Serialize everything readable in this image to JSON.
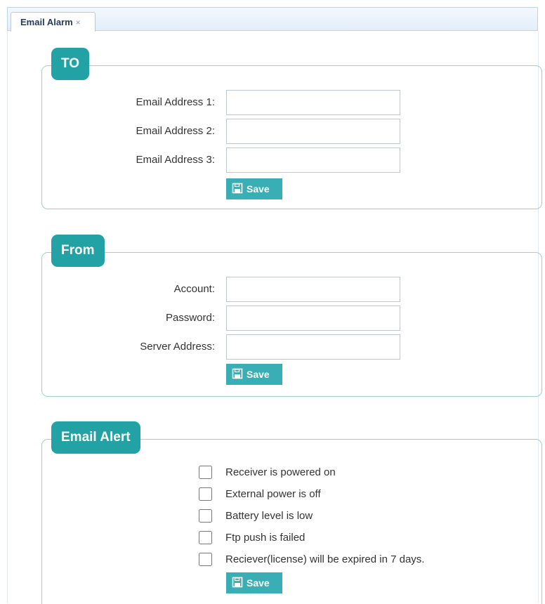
{
  "tab": {
    "label": "Email Alarm",
    "close": "×"
  },
  "to": {
    "legend": "TO",
    "fields": [
      {
        "label": "Email Address 1:",
        "value": ""
      },
      {
        "label": "Email Address 2:",
        "value": ""
      },
      {
        "label": "Email Address 3:",
        "value": ""
      }
    ],
    "save_label": "Save"
  },
  "from": {
    "legend": "From",
    "fields": [
      {
        "label": "Account:",
        "value": ""
      },
      {
        "label": "Password:",
        "value": ""
      },
      {
        "label": "Server Address:",
        "value": ""
      }
    ],
    "save_label": "Save"
  },
  "alert": {
    "legend": "Email Alert",
    "options": [
      {
        "label": "Receiver is powered on",
        "checked": false
      },
      {
        "label": "External power is off",
        "checked": false
      },
      {
        "label": "Battery level is low",
        "checked": false
      },
      {
        "label": "Ftp push is failed",
        "checked": false
      },
      {
        "label": "Reciever(license) will be expired in 7 days.",
        "checked": false
      }
    ],
    "save_label": "Save"
  },
  "colors": {
    "accent": "#23a2a6",
    "button": "#39aeb5",
    "border": "#9fcfd6"
  }
}
